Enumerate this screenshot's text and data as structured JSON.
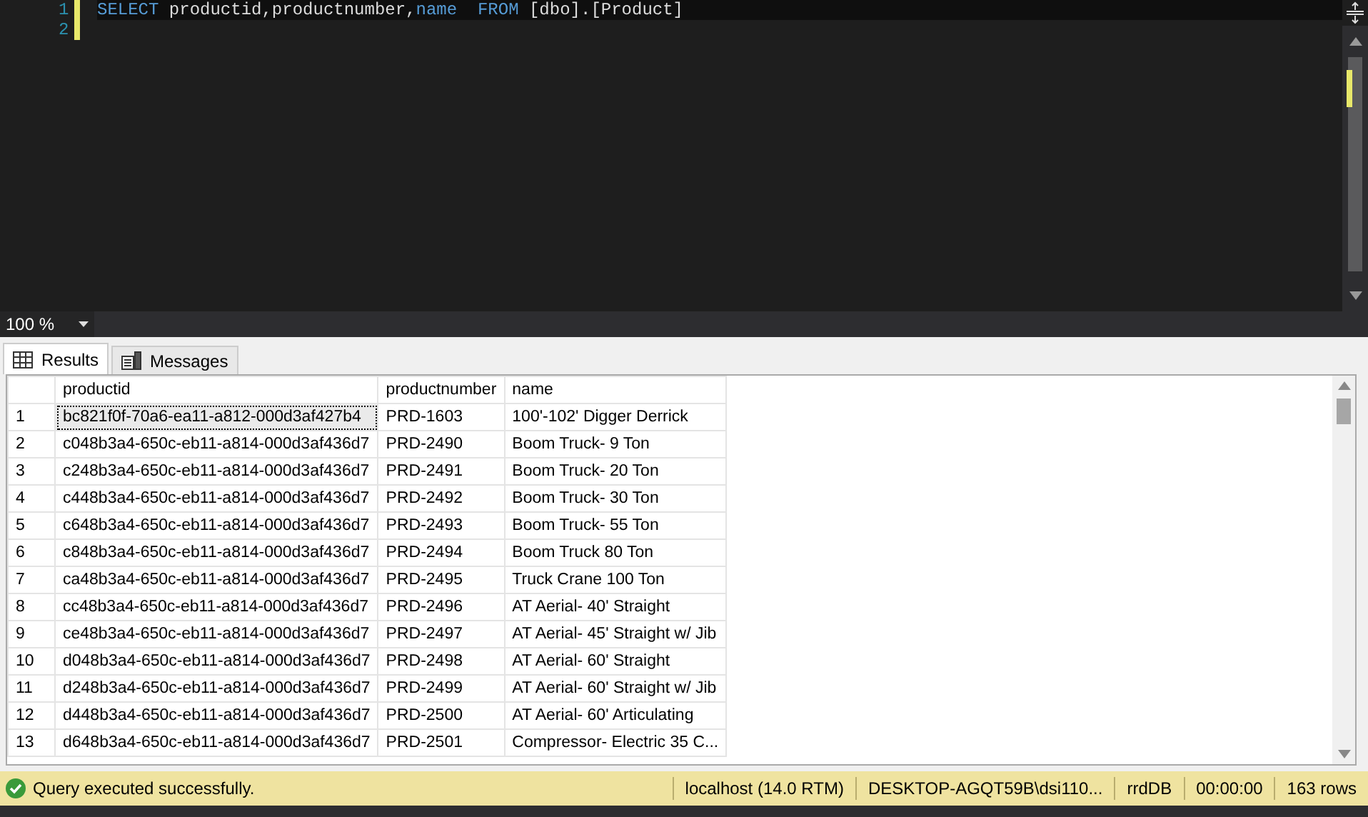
{
  "editor": {
    "lines": [
      {
        "number": "1",
        "tokens": [
          {
            "text": "SELECT",
            "kind": "keyword"
          },
          {
            "text": " productid,productnumber,",
            "kind": "plain"
          },
          {
            "text": "name",
            "kind": "keyword"
          },
          {
            "text": "  FROM",
            "kind": "keyword"
          },
          {
            "text": " [dbo].[Product]",
            "kind": "plain"
          }
        ]
      },
      {
        "number": "2"
      }
    ]
  },
  "zoom": {
    "value": "100 %"
  },
  "tabs": [
    {
      "label": "Results",
      "kind": "grid",
      "selected": true
    },
    {
      "label": "Messages",
      "kind": "messages",
      "selected": false
    }
  ],
  "table": {
    "columns": [
      "productid",
      "productnumber",
      "name"
    ],
    "rows": [
      {
        "number": "1",
        "cells": [
          "bc821f0f-70a6-ea11-a812-000d3af427b4",
          "PRD-1603",
          "100'-102' Digger Derrick"
        ],
        "selected": true
      },
      {
        "number": "2",
        "cells": [
          "c048b3a4-650c-eb11-a814-000d3af436d7",
          "PRD-2490",
          "Boom Truck- 9 Ton"
        ],
        "selected": false
      },
      {
        "number": "3",
        "cells": [
          "c248b3a4-650c-eb11-a814-000d3af436d7",
          "PRD-2491",
          "Boom Truck- 20 Ton"
        ],
        "selected": false
      },
      {
        "number": "4",
        "cells": [
          "c448b3a4-650c-eb11-a814-000d3af436d7",
          "PRD-2492",
          "Boom Truck- 30 Ton"
        ],
        "selected": false
      },
      {
        "number": "5",
        "cells": [
          "c648b3a4-650c-eb11-a814-000d3af436d7",
          "PRD-2493",
          "Boom Truck- 55 Ton"
        ],
        "selected": false
      },
      {
        "number": "6",
        "cells": [
          "c848b3a4-650c-eb11-a814-000d3af436d7",
          "PRD-2494",
          "Boom Truck 80 Ton"
        ],
        "selected": false
      },
      {
        "number": "7",
        "cells": [
          "ca48b3a4-650c-eb11-a814-000d3af436d7",
          "PRD-2495",
          "Truck Crane 100 Ton"
        ],
        "selected": false
      },
      {
        "number": "8",
        "cells": [
          "cc48b3a4-650c-eb11-a814-000d3af436d7",
          "PRD-2496",
          "AT Aerial- 40' Straight"
        ],
        "selected": false
      },
      {
        "number": "9",
        "cells": [
          "ce48b3a4-650c-eb11-a814-000d3af436d7",
          "PRD-2497",
          "AT Aerial- 45' Straight w/ Jib"
        ],
        "selected": false
      },
      {
        "number": "10",
        "cells": [
          "d048b3a4-650c-eb11-a814-000d3af436d7",
          "PRD-2498",
          "AT Aerial- 60' Straight"
        ],
        "selected": false
      },
      {
        "number": "11",
        "cells": [
          "d248b3a4-650c-eb11-a814-000d3af436d7",
          "PRD-2499",
          "AT Aerial- 60' Straight w/ Jib"
        ],
        "selected": false
      },
      {
        "number": "12",
        "cells": [
          "d448b3a4-650c-eb11-a814-000d3af436d7",
          "PRD-2500",
          "AT Aerial- 60' Articulating"
        ],
        "selected": false
      },
      {
        "number": "13",
        "cells": [
          "d648b3a4-650c-eb11-a814-000d3af436d7",
          "PRD-2501",
          "Compressor- Electric 35 C..."
        ],
        "selected": false
      }
    ]
  },
  "status_bar": {
    "message": "Query executed successfully.",
    "server": "localhost (14.0 RTM)",
    "user": "DESKTOP-AGQT59B\\dsi110...",
    "database": "rrdDB",
    "elapsed": "00:00:00",
    "row_count": "163 rows"
  }
}
